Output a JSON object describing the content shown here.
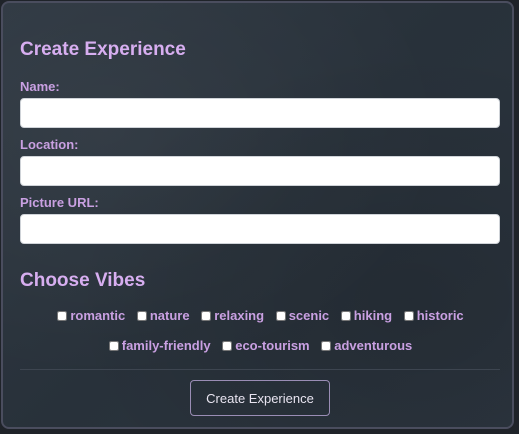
{
  "form": {
    "title": "Create Experience",
    "fields": [
      {
        "label": "Name:",
        "value": "",
        "placeholder": ""
      },
      {
        "label": "Location:",
        "value": "",
        "placeholder": ""
      },
      {
        "label": "Picture URL:",
        "value": "",
        "placeholder": ""
      }
    ]
  },
  "vibes": {
    "title": "Choose Vibes",
    "row1": [
      {
        "label": "romantic",
        "checked": false
      },
      {
        "label": "nature",
        "checked": false
      },
      {
        "label": "relaxing",
        "checked": false
      },
      {
        "label": "scenic",
        "checked": false
      },
      {
        "label": "hiking",
        "checked": false
      },
      {
        "label": "historic",
        "checked": false
      }
    ],
    "row2": [
      {
        "label": "family-friendly",
        "checked": false
      },
      {
        "label": "eco-tourism",
        "checked": false
      },
      {
        "label": "adventurous",
        "checked": false
      }
    ]
  },
  "submit": {
    "label": "Create Experience"
  },
  "colors": {
    "heading": "#d7aef0",
    "label": "#c9a0e2",
    "panel_background": "#2c353f",
    "button_border": "#9a8db5"
  }
}
